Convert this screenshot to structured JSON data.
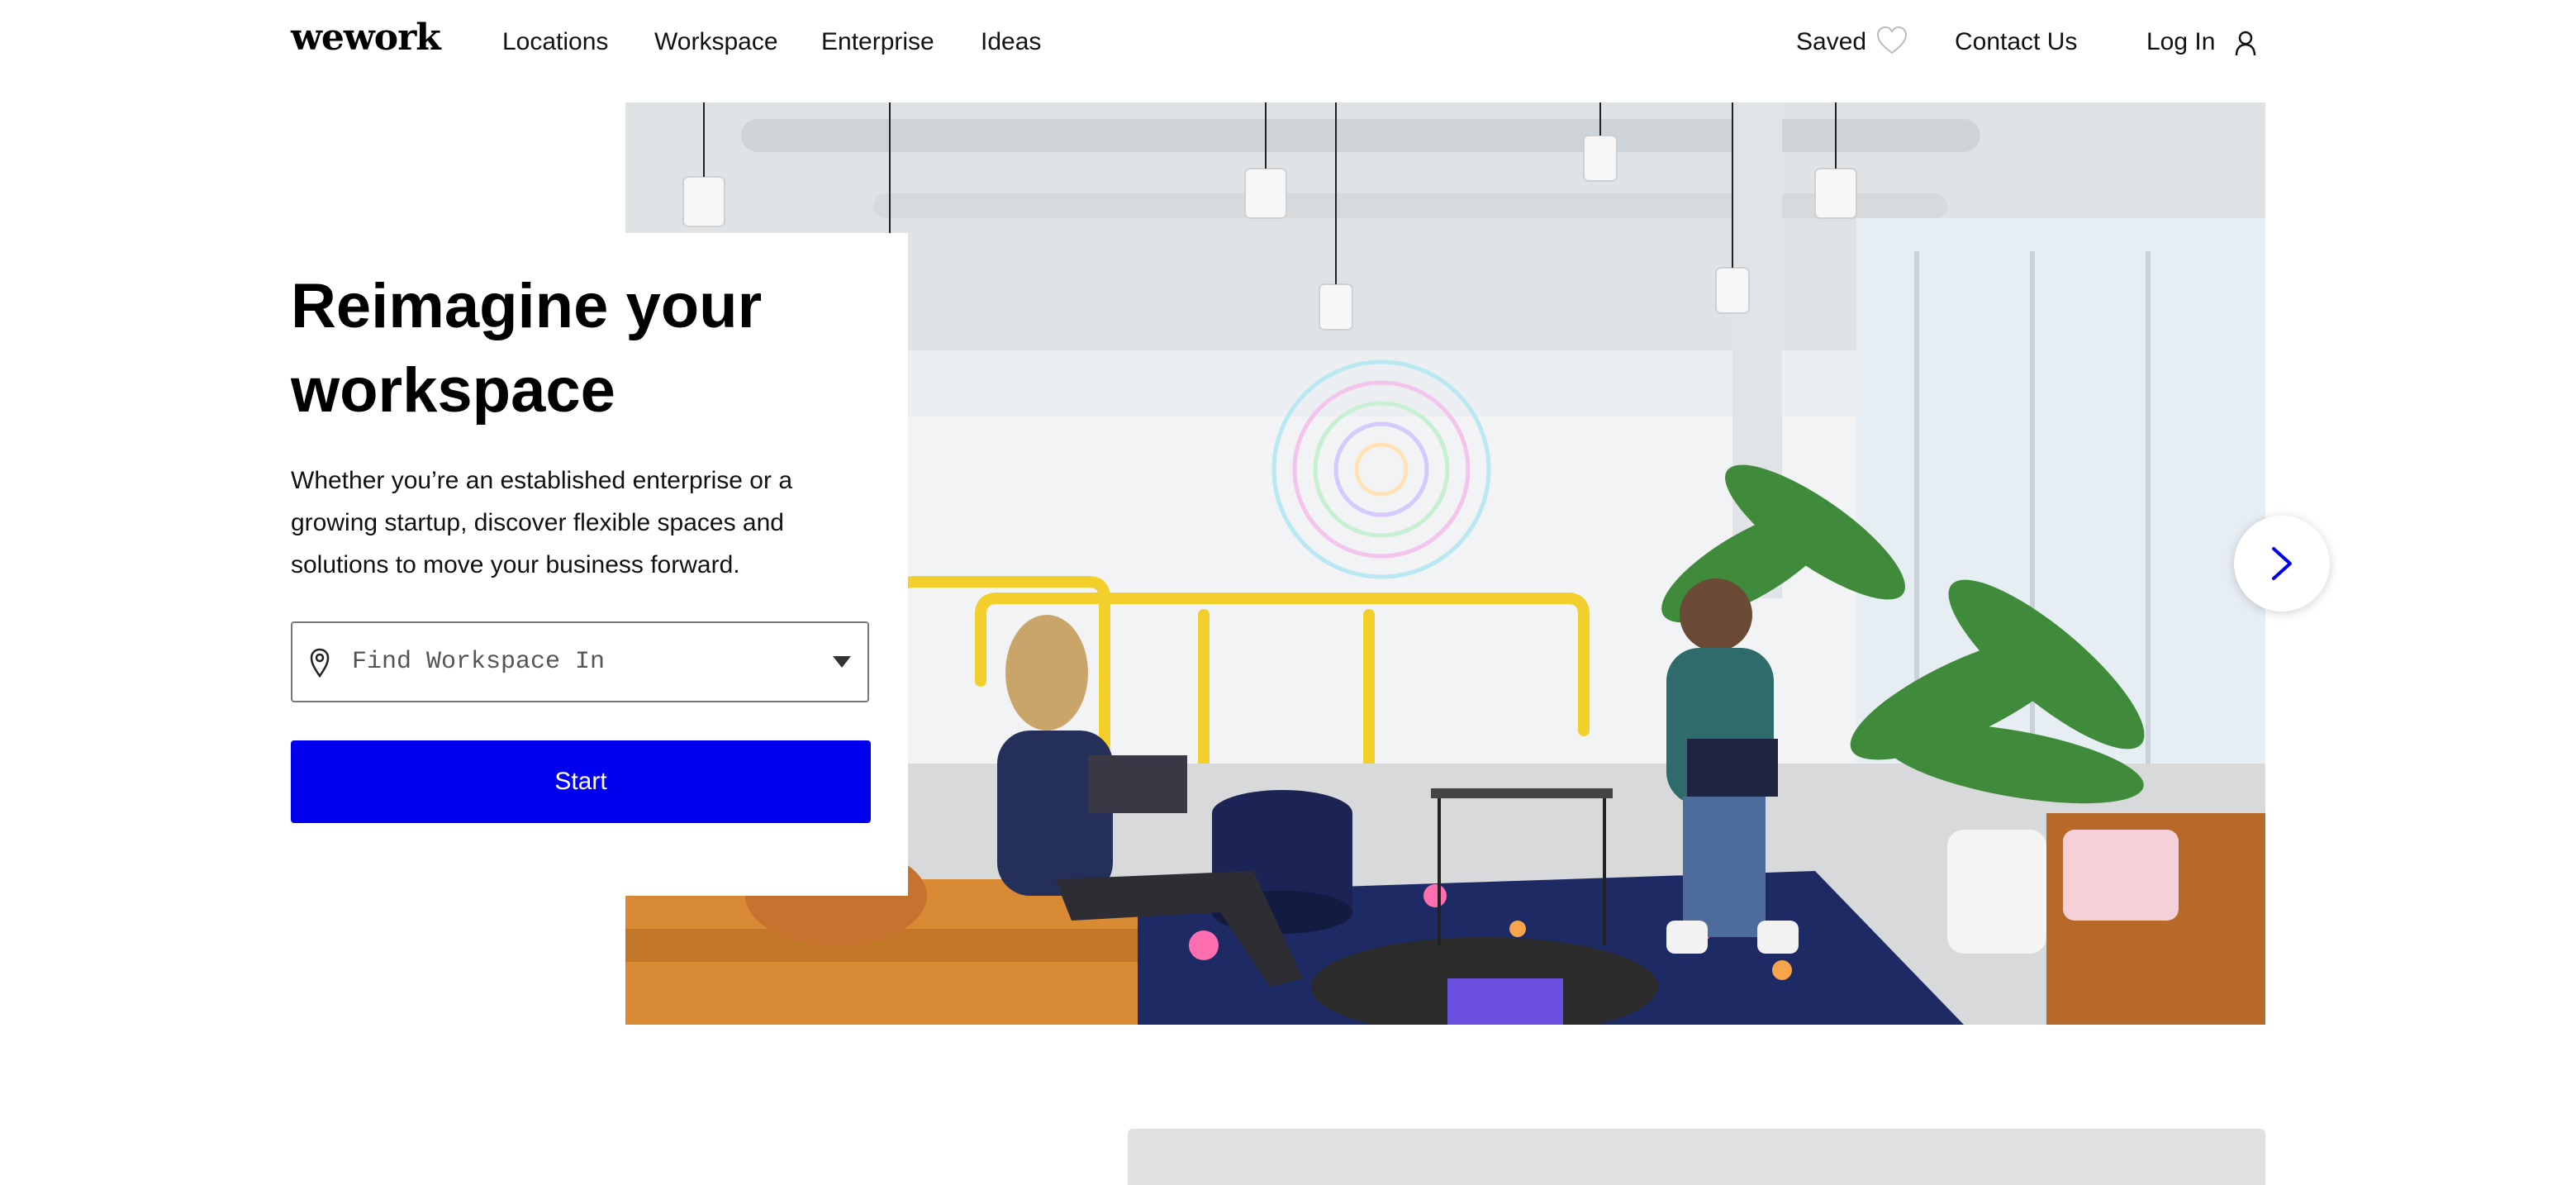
{
  "nav": {
    "logo": "wework",
    "links": [
      "Locations",
      "Workspace",
      "Enterprise",
      "Ideas"
    ],
    "saved": "Saved",
    "contact": "Contact Us",
    "login": "Log In"
  },
  "hero": {
    "title": "Reimagine your workspace",
    "description": "Whether you’re an established enterprise or a growing startup, discover flexible spaces and solutions to move your business forward.",
    "search_placeholder": "Find Workspace In",
    "start_label": "Start",
    "image_alt": "Bright coworking lounge with people working on laptops"
  },
  "icons": {
    "saved": "heart-icon",
    "login": "user-icon",
    "location": "map-pin-icon",
    "dropdown": "caret-down-icon",
    "carousel_next": "chevron-right-icon"
  },
  "colors": {
    "primary": "#0000ee",
    "text": "#000000",
    "muted_block": "#e0e0e0"
  }
}
